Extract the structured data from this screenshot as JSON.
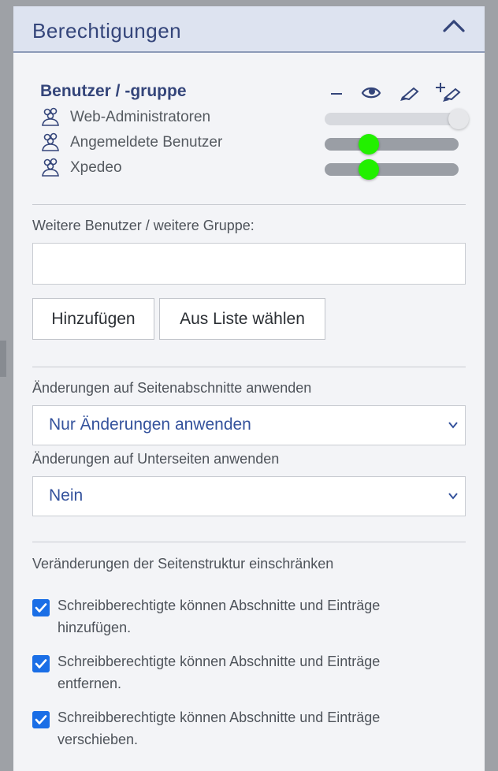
{
  "panel": {
    "title": "Berechtigungen",
    "collapse_icon": "chevron-up-icon"
  },
  "permissions": {
    "header_label": "Benutzer / -gruppe",
    "column_icons": [
      "none-dash-icon",
      "eye-read-icon",
      "pen-write-icon",
      "pen-plus-create-icon"
    ],
    "users": [
      {
        "name": "Web-Administratoren",
        "icon": "user-group-icon",
        "level": 1.0,
        "enabled": false
      },
      {
        "name": "Angemeldete Benutzer",
        "icon": "user-group-icon",
        "level": 0.33,
        "enabled": true
      },
      {
        "name": "Xpedeo",
        "icon": "user-group-icon",
        "level": 0.33,
        "enabled": true
      }
    ]
  },
  "add_user": {
    "label": "Weitere Benutzer / weitere Gruppe:",
    "input_value": "",
    "add_button": "Hinzufügen",
    "list_button": "Aus Liste wählen"
  },
  "apply_sections": {
    "label": "Änderungen auf Seitenabschnitte anwenden",
    "selected": "Nur Änderungen anwenden"
  },
  "apply_subpages": {
    "label": "Änderungen auf Unterseiten anwenden",
    "selected": "Nein"
  },
  "structure": {
    "label": "Veränderungen der Seitenstruktur einschränken",
    "options": [
      {
        "text": "Schreibberechtigte können Abschnitte und Einträge hinzufügen.",
        "checked": true
      },
      {
        "text": "Schreibberechtigte können Abschnitte und Einträge entfernen.",
        "checked": true
      },
      {
        "text": "Schreibberechtigte können Abschnitte und Einträge verschieben.",
        "checked": true
      }
    ]
  },
  "colors": {
    "accent": "#34457a",
    "slider_knob_active": "#22f000",
    "checkbox": "#1a6ee6"
  }
}
